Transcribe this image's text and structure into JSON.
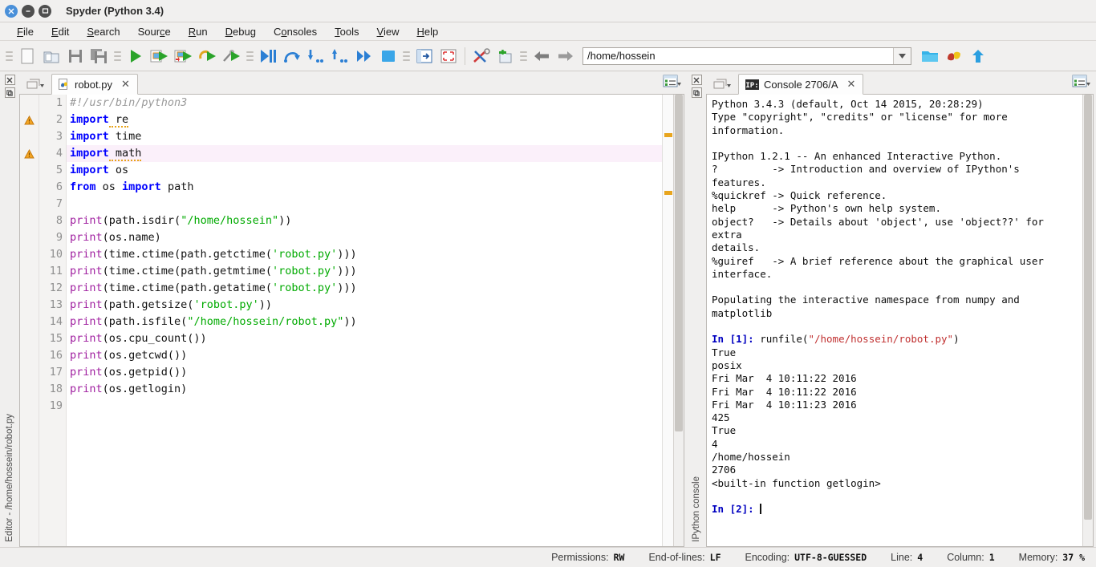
{
  "window": {
    "title": "Spyder (Python 3.4)",
    "buttons": {
      "close": "×",
      "minimize": "–",
      "maximize": "□"
    }
  },
  "menubar": {
    "items": [
      {
        "label": "File",
        "accel": "F"
      },
      {
        "label": "Edit",
        "accel": "E"
      },
      {
        "label": "Search",
        "accel": "S"
      },
      {
        "label": "Source",
        "accel": "c"
      },
      {
        "label": "Run",
        "accel": "R"
      },
      {
        "label": "Debug",
        "accel": "D"
      },
      {
        "label": "Consoles",
        "accel": "o"
      },
      {
        "label": "Tools",
        "accel": "T"
      },
      {
        "label": "View",
        "accel": "V"
      },
      {
        "label": "Help",
        "accel": "H"
      }
    ]
  },
  "toolbar": {
    "icons": [
      "new-file-icon",
      "open-file-icon",
      "save-file-icon",
      "save-all-icon",
      "run-icon",
      "run-cell-icon",
      "run-cell-advance-icon",
      "run-selection-icon",
      "configure-run-icon",
      "debug-icon",
      "debug-step-over-icon",
      "debug-step-into-icon",
      "debug-step-return-icon",
      "debug-continue-icon",
      "debug-stop-icon",
      "maximize-pane-icon",
      "fullscreen-icon",
      "preferences-icon",
      "pythonpath-manager-icon",
      "back-icon",
      "forward-icon"
    ],
    "path_value": "/home/hossein",
    "right_icons": [
      "open-folder-icon",
      "python-file-icon",
      "parent-dir-icon"
    ]
  },
  "editor": {
    "vertical_label": "Editor - /home/hossein/robot.py",
    "tab": {
      "label": "robot.py",
      "icon": "python-file-icon",
      "close": "✕"
    },
    "options_icon": "options-list-icon",
    "pane_buttons": [
      "close-pane-icon",
      "undock-pane-icon"
    ],
    "lines": [
      {
        "n": 1,
        "warn": false,
        "current": false,
        "tokens": [
          {
            "t": "#!/usr/bin/python3",
            "c": "cmt"
          }
        ]
      },
      {
        "n": 2,
        "warn": true,
        "current": false,
        "tokens": [
          {
            "t": "import",
            "c": "kw"
          },
          {
            "t": " re",
            "c": "pl"
          }
        ]
      },
      {
        "n": 3,
        "warn": false,
        "current": false,
        "tokens": [
          {
            "t": "import",
            "c": "kw"
          },
          {
            "t": " time",
            "c": "pl"
          }
        ]
      },
      {
        "n": 4,
        "warn": true,
        "current": true,
        "tokens": [
          {
            "t": "import",
            "c": "kw"
          },
          {
            "t": " math",
            "c": "pl"
          }
        ]
      },
      {
        "n": 5,
        "warn": false,
        "current": false,
        "tokens": [
          {
            "t": "import",
            "c": "kw"
          },
          {
            "t": " os",
            "c": "pl"
          }
        ]
      },
      {
        "n": 6,
        "warn": false,
        "current": false,
        "tokens": [
          {
            "t": "from",
            "c": "kw"
          },
          {
            "t": " os ",
            "c": "pl"
          },
          {
            "t": "import",
            "c": "kw"
          },
          {
            "t": " path",
            "c": "pl"
          }
        ]
      },
      {
        "n": 7,
        "warn": false,
        "current": false,
        "tokens": []
      },
      {
        "n": 8,
        "warn": false,
        "current": false,
        "tokens": [
          {
            "t": "print",
            "c": "bi"
          },
          {
            "t": "(path.isdir(",
            "c": "pl"
          },
          {
            "t": "\"/home/hossein\"",
            "c": "str"
          },
          {
            "t": "))",
            "c": "pl"
          }
        ]
      },
      {
        "n": 9,
        "warn": false,
        "current": false,
        "tokens": [
          {
            "t": "print",
            "c": "bi"
          },
          {
            "t": "(os.name)",
            "c": "pl"
          }
        ]
      },
      {
        "n": 10,
        "warn": false,
        "current": false,
        "tokens": [
          {
            "t": "print",
            "c": "bi"
          },
          {
            "t": "(time.ctime(path.getctime(",
            "c": "pl"
          },
          {
            "t": "'robot.py'",
            "c": "str"
          },
          {
            "t": ")))",
            "c": "pl"
          }
        ]
      },
      {
        "n": 11,
        "warn": false,
        "current": false,
        "tokens": [
          {
            "t": "print",
            "c": "bi"
          },
          {
            "t": "(time.ctime(path.getmtime(",
            "c": "pl"
          },
          {
            "t": "'robot.py'",
            "c": "str"
          },
          {
            "t": ")))",
            "c": "pl"
          }
        ]
      },
      {
        "n": 12,
        "warn": false,
        "current": false,
        "tokens": [
          {
            "t": "print",
            "c": "bi"
          },
          {
            "t": "(time.ctime(path.getatime(",
            "c": "pl"
          },
          {
            "t": "'robot.py'",
            "c": "str"
          },
          {
            "t": ")))",
            "c": "pl"
          }
        ]
      },
      {
        "n": 13,
        "warn": false,
        "current": false,
        "tokens": [
          {
            "t": "print",
            "c": "bi"
          },
          {
            "t": "(path.getsize(",
            "c": "pl"
          },
          {
            "t": "'robot.py'",
            "c": "str"
          },
          {
            "t": "))",
            "c": "pl"
          }
        ]
      },
      {
        "n": 14,
        "warn": false,
        "current": false,
        "tokens": [
          {
            "t": "print",
            "c": "bi"
          },
          {
            "t": "(path.isfile(",
            "c": "pl"
          },
          {
            "t": "\"/home/hossein/robot.py\"",
            "c": "str"
          },
          {
            "t": "))",
            "c": "pl"
          }
        ]
      },
      {
        "n": 15,
        "warn": false,
        "current": false,
        "tokens": [
          {
            "t": "print",
            "c": "bi"
          },
          {
            "t": "(os.cpu_count())",
            "c": "pl"
          }
        ]
      },
      {
        "n": 16,
        "warn": false,
        "current": false,
        "tokens": [
          {
            "t": "print",
            "c": "bi"
          },
          {
            "t": "(os.getcwd())",
            "c": "pl"
          }
        ]
      },
      {
        "n": 17,
        "warn": false,
        "current": false,
        "tokens": [
          {
            "t": "print",
            "c": "bi"
          },
          {
            "t": "(os.getpid())",
            "c": "pl"
          }
        ]
      },
      {
        "n": 18,
        "warn": false,
        "current": false,
        "tokens": [
          {
            "t": "print",
            "c": "bi"
          },
          {
            "t": "(os.getlogin)",
            "c": "pl"
          }
        ]
      },
      {
        "n": 19,
        "warn": false,
        "current": false,
        "tokens": []
      }
    ]
  },
  "console": {
    "vertical_label": "IPython console",
    "tab": {
      "label": "Console 2706/A",
      "icon": "ipython-icon",
      "close": "✕"
    },
    "options_icon": "options-list-icon",
    "pane_buttons": [
      "close-pane-icon",
      "undock-pane-icon"
    ],
    "banner": [
      "Python 3.4.3 (default, Oct 14 2015, 20:28:29)",
      "Type \"copyright\", \"credits\" or \"license\" for more information.",
      "",
      "IPython 1.2.1 -- An enhanced Interactive Python.",
      "?         -> Introduction and overview of IPython's features.",
      "%quickref -> Quick reference.",
      "help      -> Python's own help system.",
      "object?   -> Details about 'object', use 'object??' for extra",
      "details.",
      "%guiref   -> A brief reference about the graphical user",
      "interface.",
      ""
    ],
    "pylab_line": "Populating the interactive namespace from numpy and matplotlib",
    "prompt1": {
      "label_before": "In [",
      "number": "1",
      "label_after": "]: "
    },
    "command1_plain": "runfile(",
    "command1_string": "\"/home/hossein/robot.py\"",
    "command1_tail": ")",
    "output": [
      "True",
      "posix",
      "Fri Mar  4 10:11:22 2016",
      "Fri Mar  4 10:11:22 2016",
      "Fri Mar  4 10:11:23 2016",
      "425",
      "True",
      "4",
      "/home/hossein",
      "2706",
      "<built-in function getlogin>"
    ],
    "prompt2": {
      "label_before": "In [",
      "number": "2",
      "label_after": "]: "
    }
  },
  "statusbar": {
    "items": [
      {
        "label": "Permissions:",
        "value": "RW"
      },
      {
        "label": "End-of-lines:",
        "value": "LF"
      },
      {
        "label": "Encoding:",
        "value": "UTF-8-GUESSED"
      },
      {
        "label": "Line:",
        "value": "4"
      },
      {
        "label": "Column:",
        "value": "1"
      },
      {
        "label": "Memory:",
        "value": "37 %"
      }
    ]
  },
  "colors": {
    "accent_blue": "#4a90d9",
    "keyword": "#0000ff",
    "builtin": "#a020a0",
    "string": "#00aa00",
    "comment": "#9a9a9a",
    "warning": "#e8a51e",
    "prompt": "#0000c0",
    "command_string": "#c03030",
    "current_line": "#fbf0fa",
    "chrome": "#f0efee"
  }
}
